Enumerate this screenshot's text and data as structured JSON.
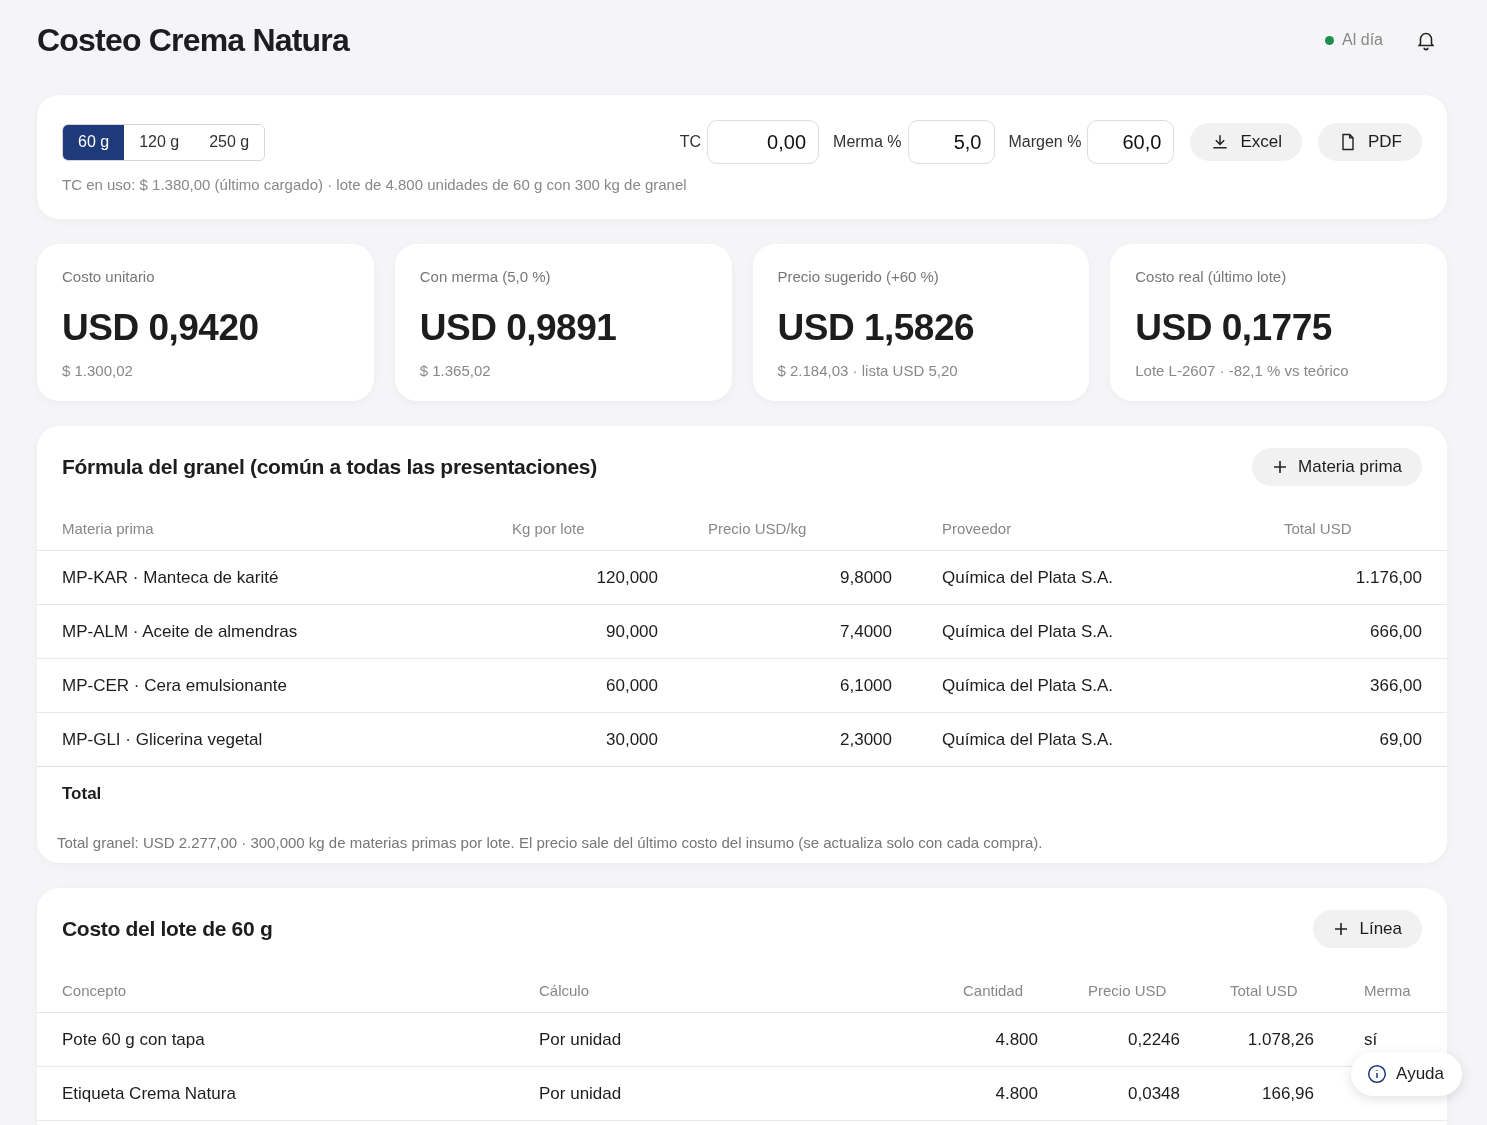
{
  "header": {
    "title": "Costeo Crema Natura",
    "status": {
      "label": "Al día",
      "color": "#1e8e4e"
    }
  },
  "controls": {
    "sizes": [
      {
        "label": "60 g",
        "selected": true
      },
      {
        "label": "120 g",
        "selected": false
      },
      {
        "label": "250 g",
        "selected": false
      }
    ],
    "fields": [
      {
        "label": "TC",
        "value": "0,00"
      },
      {
        "label": "Merma %",
        "value": "5,0"
      },
      {
        "label": "Margen %",
        "value": "60,0"
      }
    ],
    "buttons": [
      {
        "label": "Excel",
        "kind": "download"
      },
      {
        "label": "PDF",
        "kind": "file"
      }
    ],
    "note": "TC en uso: $ 1.380,00 (último cargado) · lote de 4.800 unidades de 60 g con 300 kg de granel"
  },
  "kpis": [
    {
      "label": "Costo unitario",
      "value": "USD 0,9420",
      "sub": "$ 1.300,02"
    },
    {
      "label": "Con merma (5,0 %)",
      "value": "USD 0,9891",
      "sub": "$ 1.365,02"
    },
    {
      "label": "Precio sugerido (+60 %)",
      "value": "USD 1,5826",
      "sub": "$ 2.184,03 · lista USD 5,20"
    },
    {
      "label": "Costo real (último lote)",
      "value": "USD 0,1775",
      "sub": "Lote L-2607 · -82,1 % vs teórico"
    }
  ],
  "formula": {
    "title": "Fórmula del granel (común a todas las presentaciones)",
    "add_button": "Materia prima",
    "columns": [
      "Materia prima",
      "Kg por lote",
      "Precio USD/kg",
      "Proveedor",
      "Total USD"
    ],
    "rows": [
      [
        "MP-KAR · Manteca de karité",
        "120,000",
        "9,8000",
        "Química del Plata S.A.",
        "1.176,00"
      ],
      [
        "MP-ALM · Aceite de almendras",
        "90,000",
        "7,4000",
        "Química del Plata S.A.",
        "666,00"
      ],
      [
        "MP-CER · Cera emulsionante",
        "60,000",
        "6,1000",
        "Química del Plata S.A.",
        "366,00"
      ],
      [
        "MP-GLI · Glicerina vegetal",
        "30,000",
        "2,3000",
        "Química del Plata S.A.",
        "69,00"
      ]
    ],
    "total_label": "Total",
    "footnote": "Total granel: USD 2.277,00 · 300,000 kg de materias primas por lote. El precio sale del último costo del insumo (se actualiza solo con cada compra)."
  },
  "batch": {
    "title": "Costo del lote de 60 g",
    "add_button": "Línea",
    "columns": [
      "Concepto",
      "Cálculo",
      "Cantidad",
      "Precio USD",
      "Total USD",
      "Merma"
    ],
    "rows": [
      [
        "Pote 60 g con tapa",
        "Por unidad",
        "4.800",
        "0,2246",
        "1.078,26",
        "sí"
      ],
      [
        "Etiqueta Crema Natura",
        "Por unidad",
        "4.800",
        "0,0348",
        "166,96"
      ]
    ]
  },
  "help_button": "Ayuda"
}
